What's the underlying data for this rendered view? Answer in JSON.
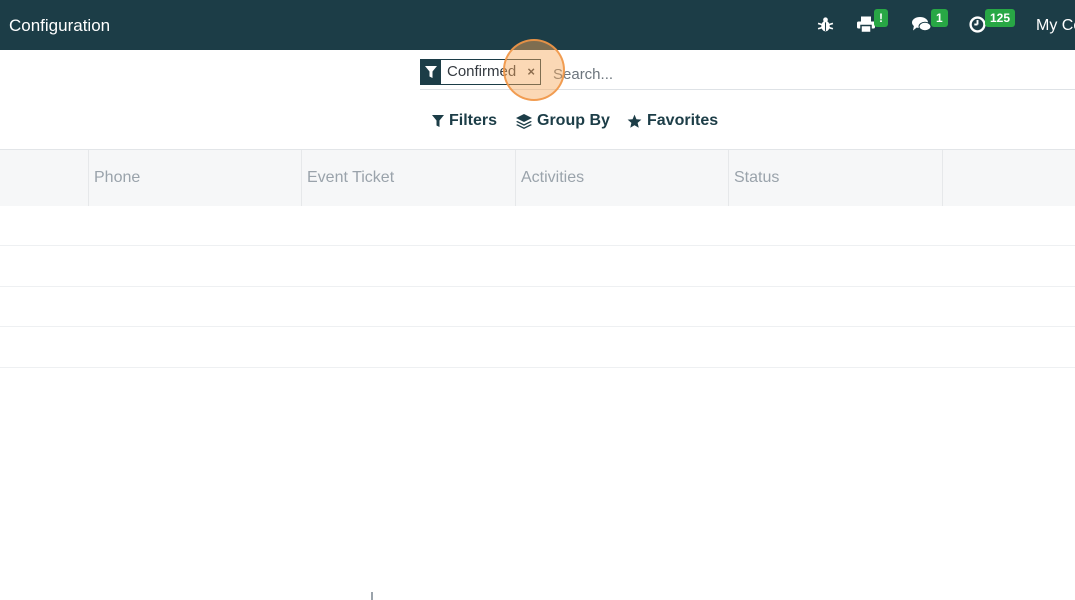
{
  "topbar": {
    "app_title": "Configuration",
    "company": "My Co",
    "icons": {
      "debug": "bug-icon",
      "print": "printer-icon",
      "messages": "chat-icon",
      "activities": "clock-icon"
    },
    "badges": {
      "print": "!",
      "messages": "1",
      "activities": "125"
    },
    "colors": {
      "bar": "#1c3d47",
      "badge": "#28a745"
    }
  },
  "search": {
    "facet_label": "Confirmed",
    "facet_remove": "×",
    "placeholder": "Search..."
  },
  "filters": {
    "filters_label": "Filters",
    "group_by_label": "Group By",
    "favorites_label": "Favorites"
  },
  "table": {
    "columns": [
      "Phone",
      "Event Ticket",
      "Activities",
      "Status"
    ]
  }
}
